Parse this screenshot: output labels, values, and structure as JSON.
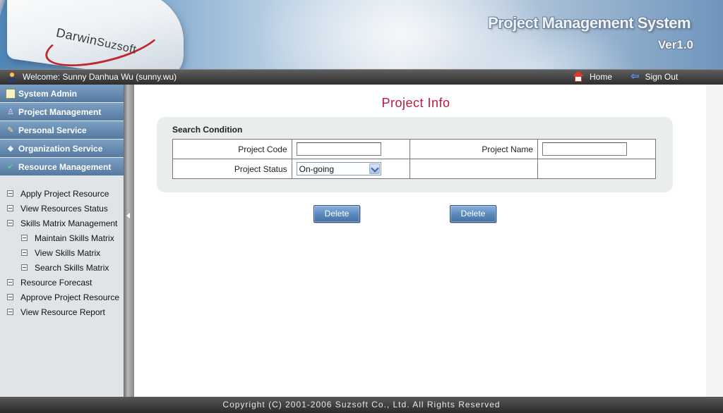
{
  "header": {
    "logo_primary": "Darwin",
    "logo_secondary": "Suzsoft",
    "system_title": "Project Management System",
    "version": "Ver1.0"
  },
  "topbar": {
    "welcome": "Welcome: Sunny Danhua Wu (sunny.wu)",
    "home_label": "Home",
    "signout_label": "Sign Out"
  },
  "sidebar": {
    "groups": [
      {
        "label": "System Admin",
        "icon": "table-icon"
      },
      {
        "label": "Project Management",
        "icon": "person-icon"
      },
      {
        "label": "Personal Service",
        "icon": "pen-icon"
      },
      {
        "label": "Organization Service",
        "icon": "diamond-icon"
      },
      {
        "label": "Resource Management",
        "icon": "shield-icon"
      }
    ],
    "items": [
      {
        "label": "Apply Project Resource"
      },
      {
        "label": "View Resources Status"
      },
      {
        "label": "Skills Matrix Management"
      },
      {
        "label": "Maintain Skills Matrix"
      },
      {
        "label": "View Skills Matrix"
      },
      {
        "label": "Search Skills Matrix"
      },
      {
        "label": "Resource Forecast"
      },
      {
        "label": "Approve Project Resource"
      },
      {
        "label": "View Resource Report"
      }
    ]
  },
  "main": {
    "title": "Project Info",
    "search": {
      "title": "Search Condition",
      "project_code_label": "Project Code",
      "project_code_value": "",
      "project_name_label": "Project Name",
      "project_name_value": "",
      "project_status_label": "Project Status",
      "project_status_value": "On-going"
    },
    "buttons": {
      "delete_1": "Delete",
      "delete_2": "Delete"
    }
  },
  "footer": {
    "copyright": "Copyright (C) 2001-2006 Suzsoft Co., Ltd. All Rights Reserved"
  },
  "colors": {
    "title_red": "#c0173d",
    "menu_blue": "#55799f",
    "button_blue": "#5d8bbf"
  }
}
